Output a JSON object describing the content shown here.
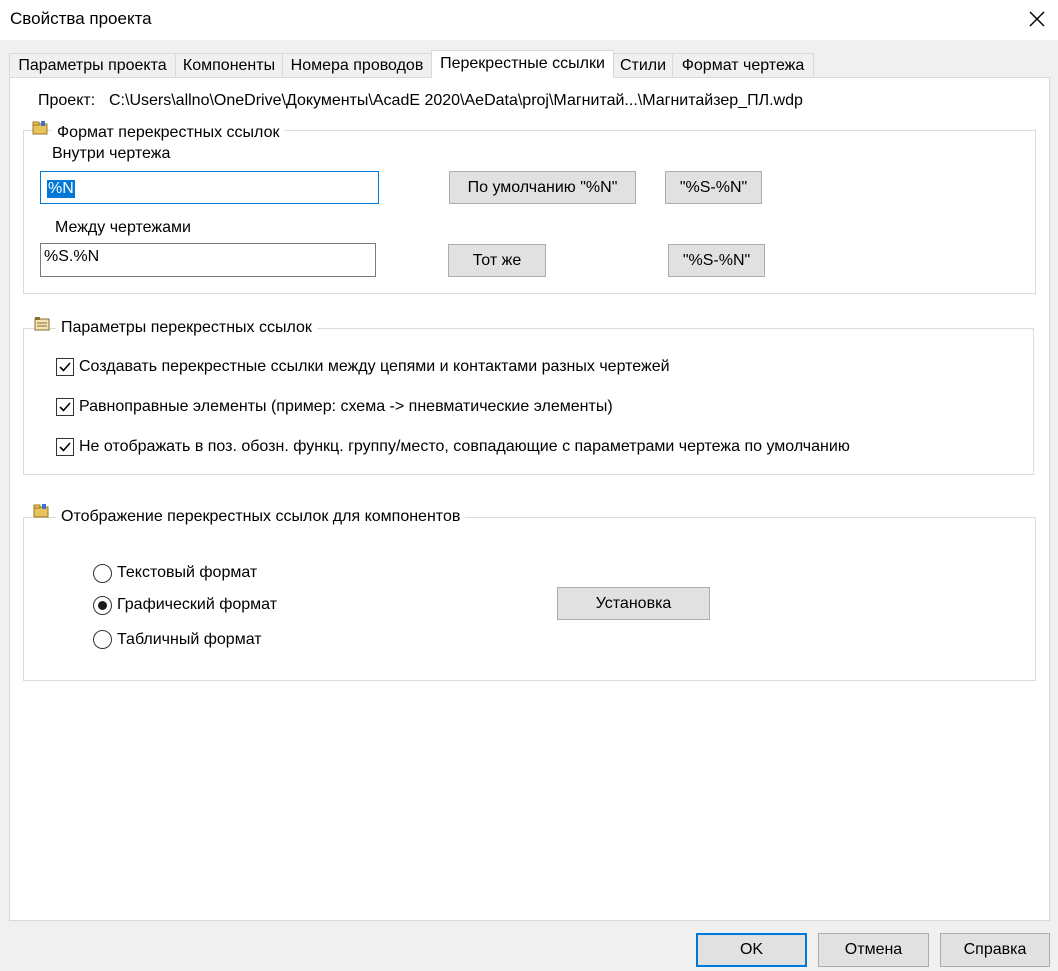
{
  "window": {
    "title": "Свойства проекта"
  },
  "tabs": [
    {
      "label": "Параметры проекта",
      "active": false
    },
    {
      "label": "Компоненты",
      "active": false
    },
    {
      "label": "Номера проводов",
      "active": false
    },
    {
      "label": "Перекрестные ссылки",
      "active": true
    },
    {
      "label": "Стили",
      "active": false
    },
    {
      "label": "Формат чертежа",
      "active": false
    }
  ],
  "project": {
    "label": "Проект:",
    "path": "C:\\Users\\allno\\OneDrive\\Документы\\AcadE 2020\\AeData\\proj\\Магнитай...\\Магнитайзер_ПЛ.wdp"
  },
  "format_group": {
    "title": "Формат перекрестных ссылок",
    "within_label": "Внутри чертежа",
    "within_value": "%N",
    "default_button": "По умолчанию \"%N\"",
    "within_alt_button": "\"%S-%N\"",
    "between_label": "Между чертежами",
    "between_value": "%S.%N",
    "same_button": "Тот же",
    "between_alt_button": "\"%S-%N\""
  },
  "params_group": {
    "title": "Параметры перекрестных ссылок",
    "options": [
      {
        "label": "Создавать перекрестные ссылки между цепями и контактами разных чертежей",
        "checked": true
      },
      {
        "label": "Равноправные элементы (пример: схема -> пневматические элементы)",
        "checked": true
      },
      {
        "label": "Не отображать в поз. обозн. функц. группу/место, совпадающие с параметрами чертежа по умолчанию",
        "checked": true
      }
    ]
  },
  "display_group": {
    "title": "Отображение перекрестных ссылок для компонентов",
    "options": [
      {
        "label": "Текстовый формат",
        "selected": false
      },
      {
        "label": "Графический формат",
        "selected": true
      },
      {
        "label": "Табличный формат",
        "selected": false
      }
    ],
    "setup_button": "Установка"
  },
  "footer": {
    "ok": "OK",
    "cancel": "Отмена",
    "help": "Справка"
  },
  "colors": {
    "accent": "#0078d7",
    "button_face": "#e1e1e1",
    "dialog_bg": "#f0f0f0"
  },
  "icons": {
    "close": "close-icon",
    "folder": "folder-icon",
    "settings": "settings-icon"
  }
}
